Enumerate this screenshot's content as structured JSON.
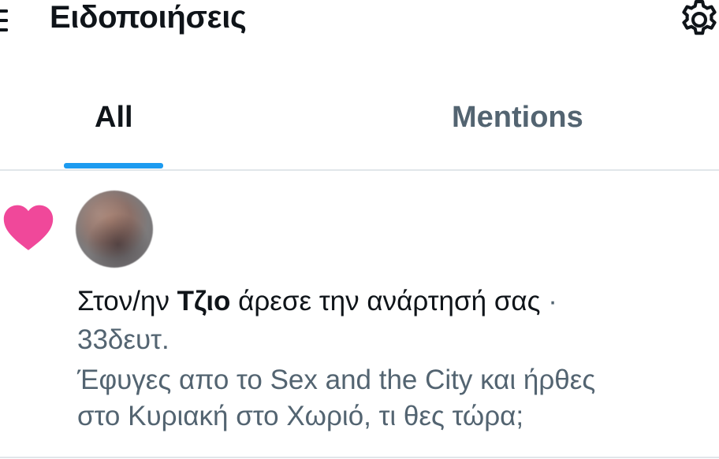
{
  "header": {
    "title": "Ειδοποιήσεις",
    "menu_icon": "hamburger-menu-icon",
    "settings_icon": "gear-icon"
  },
  "tabs": [
    {
      "label": "All",
      "selected": true
    },
    {
      "label": "Mentions",
      "selected": false
    }
  ],
  "notification": {
    "type_icon": "heart-icon",
    "avatar": "avatar",
    "prefix": "Στον/ην ",
    "user_name": "Τζιο",
    "action": " άρεσε την ανάρτησή σας",
    "separator": " ·",
    "time": "33δευτ.",
    "post_text": "Έφυγες απο το Sex and the City και ήρθες\nστο Κυριακή στο Χωριό,  τι θες τώρα;"
  },
  "colors": {
    "accent": "#1d9bf0",
    "like": "#f0489a",
    "text_primary": "#0f1419",
    "text_secondary": "#536471",
    "divider": "#e1e6ea"
  }
}
